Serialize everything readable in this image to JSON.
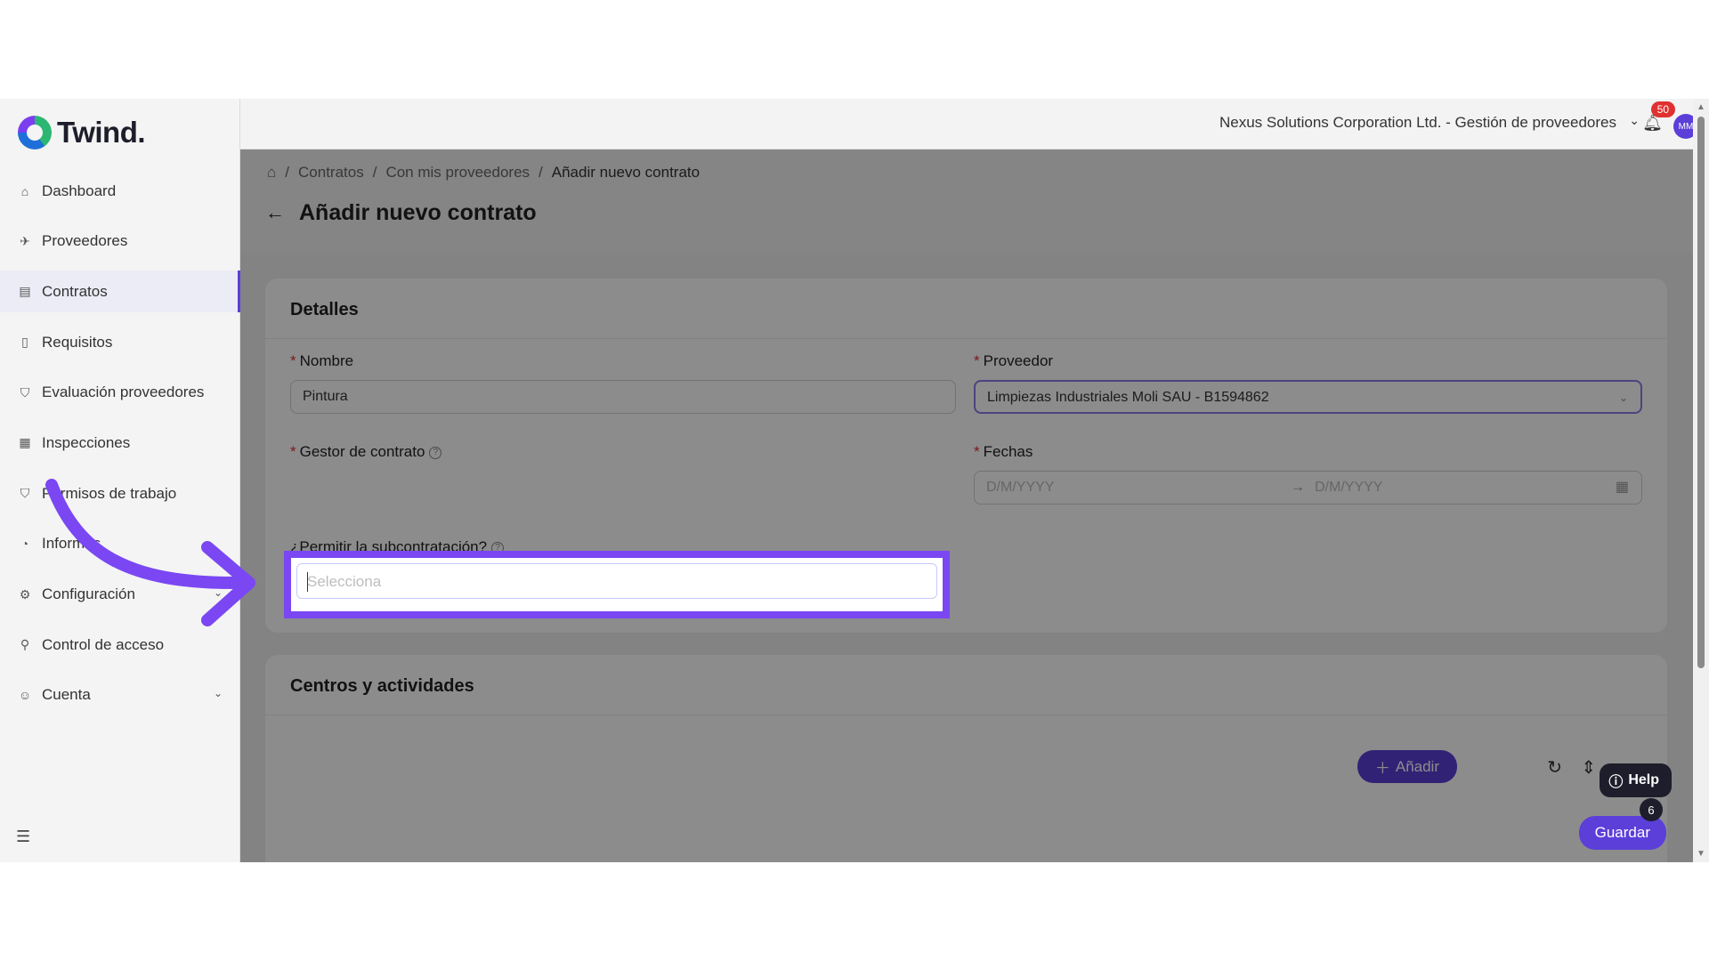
{
  "app": {
    "brand": "Twind."
  },
  "sidebar": {
    "items": [
      {
        "label": "Dashboard",
        "icon": "home-icon"
      },
      {
        "label": "Proveedores",
        "icon": "rocket-icon"
      },
      {
        "label": "Contratos",
        "icon": "contract-icon",
        "active": true
      },
      {
        "label": "Requisitos",
        "icon": "document-icon"
      },
      {
        "label": "Evaluación proveedores",
        "icon": "shield-icon"
      },
      {
        "label": "Inspecciones",
        "icon": "inspection-icon"
      },
      {
        "label": "Permisos de trabajo",
        "icon": "badge-icon"
      },
      {
        "label": "Informes",
        "icon": "chart-icon"
      },
      {
        "label": "Configuración",
        "icon": "gear-icon",
        "expandable": true
      },
      {
        "label": "Control de acceso",
        "icon": "key-icon"
      },
      {
        "label": "Cuenta",
        "icon": "smile-icon",
        "expandable": true
      }
    ]
  },
  "header": {
    "company": "Nexus Solutions Corporation Ltd. - Gestión de proveedores",
    "notifications": "50",
    "avatar": "MM"
  },
  "breadcrumb": [
    "Contratos",
    "Con mis proveedores",
    "Añadir nuevo contrato"
  ],
  "page": {
    "title": "Añadir nuevo contrato"
  },
  "details": {
    "title": "Detalles",
    "nombre_label": "Nombre",
    "nombre_value": "Pintura",
    "proveedor_label": "Proveedor",
    "proveedor_value": "Limpiezas Industriales Moli SAU - B1594862",
    "gestor_label": "Gestor de contrato",
    "gestor_placeholder": "Selecciona",
    "fechas_label": "Fechas",
    "fecha_inicio_placeholder": "D/M/YYYY",
    "fecha_fin_placeholder": "D/M/YYYY",
    "subcontratacion_label": "¿Permitir la subcontratación?"
  },
  "centros": {
    "title": "Centros y actividades",
    "add_label": "Añadir"
  },
  "footer": {
    "save_label": "Guardar",
    "help_label": "Help",
    "help_count": "6"
  },
  "colors": {
    "accent": "#5b3fd8",
    "highlight": "#7a47f3",
    "required": "#e03131"
  }
}
